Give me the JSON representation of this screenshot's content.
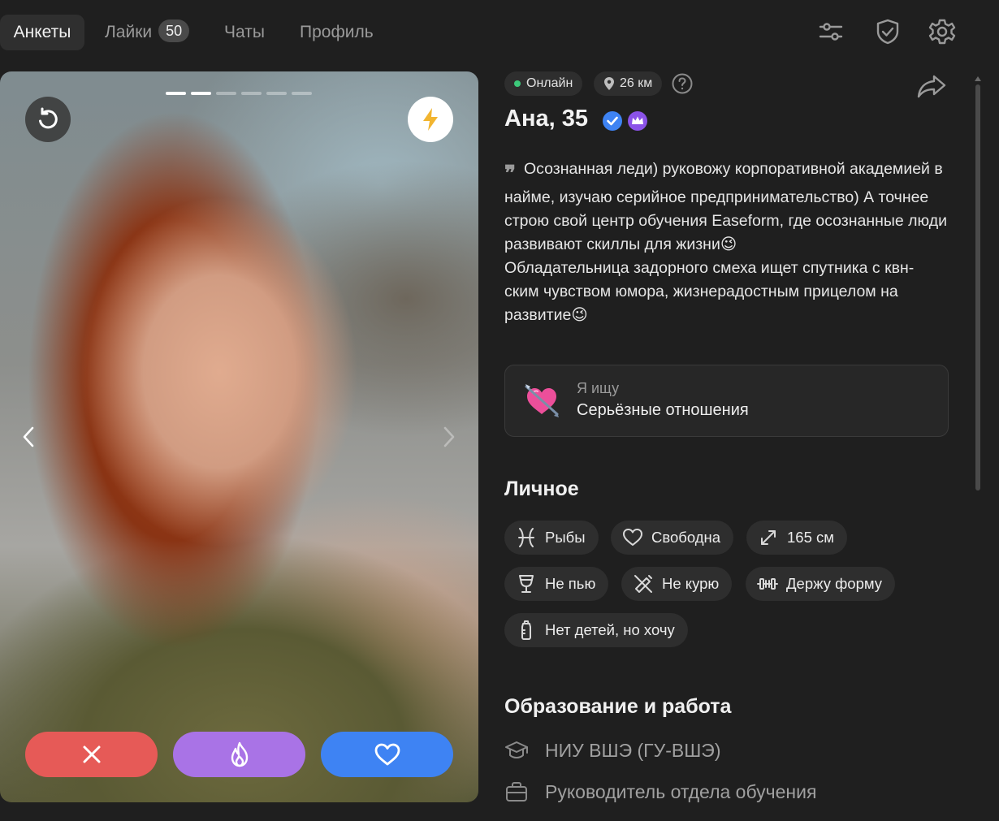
{
  "nav": {
    "tabs": [
      {
        "label": "Анкеты"
      },
      {
        "label": "Лайки",
        "badge": "50"
      },
      {
        "label": "Чаты"
      },
      {
        "label": "Профиль"
      }
    ],
    "icons": [
      "sliders-icon",
      "shield-check-icon",
      "gear-icon"
    ]
  },
  "photo": {
    "indicator_count": 6,
    "current_index": 1,
    "actions": [
      "undo-icon",
      "lightning-icon",
      "close-icon",
      "flame-icon",
      "heart-icon"
    ]
  },
  "profile": {
    "status": "Онлайн",
    "distance": "26 км",
    "name_age": "Ана, 35",
    "bio": "Осознанная леди) руковожу корпоративной академией в найме, изучаю серийное предпринимательство) А точнее строю свой центр обучения Easeform, где осознанные люди развивают скиллы для жизни😉\nОбладательница задорного смеха ищет спутника с квн-ским чувством юмора, жизнерадостным прицелом на развитие😉",
    "looking": {
      "label": "Я ищу",
      "value": "Серьёзные отношения"
    }
  },
  "personal": {
    "title": "Личное",
    "chips": [
      {
        "icon": "pisces-icon",
        "label": "Рыбы"
      },
      {
        "icon": "heart-outline-icon",
        "label": "Свободна"
      },
      {
        "icon": "expand-icon",
        "label": "165 см"
      },
      {
        "icon": "glass-icon",
        "label": "Не пью"
      },
      {
        "icon": "no-smoking-icon",
        "label": "Не курю"
      },
      {
        "icon": "dumbbell-icon",
        "label": "Держу форму"
      },
      {
        "icon": "baby-bottle-icon",
        "label": "Нет детей, но хочу"
      }
    ]
  },
  "education": {
    "title": "Образование и работа",
    "items": [
      {
        "icon": "graduation-cap-icon",
        "label": "НИУ ВШЭ (ГУ-ВШЭ)"
      },
      {
        "icon": "briefcase-icon",
        "label": "Руководитель отдела обучения"
      }
    ]
  },
  "colors": {
    "background": "#1f1f1f",
    "dislike": "#e65a57",
    "superlike": "#a973e6",
    "like": "#3e83f3",
    "online": "#3cc97a"
  }
}
